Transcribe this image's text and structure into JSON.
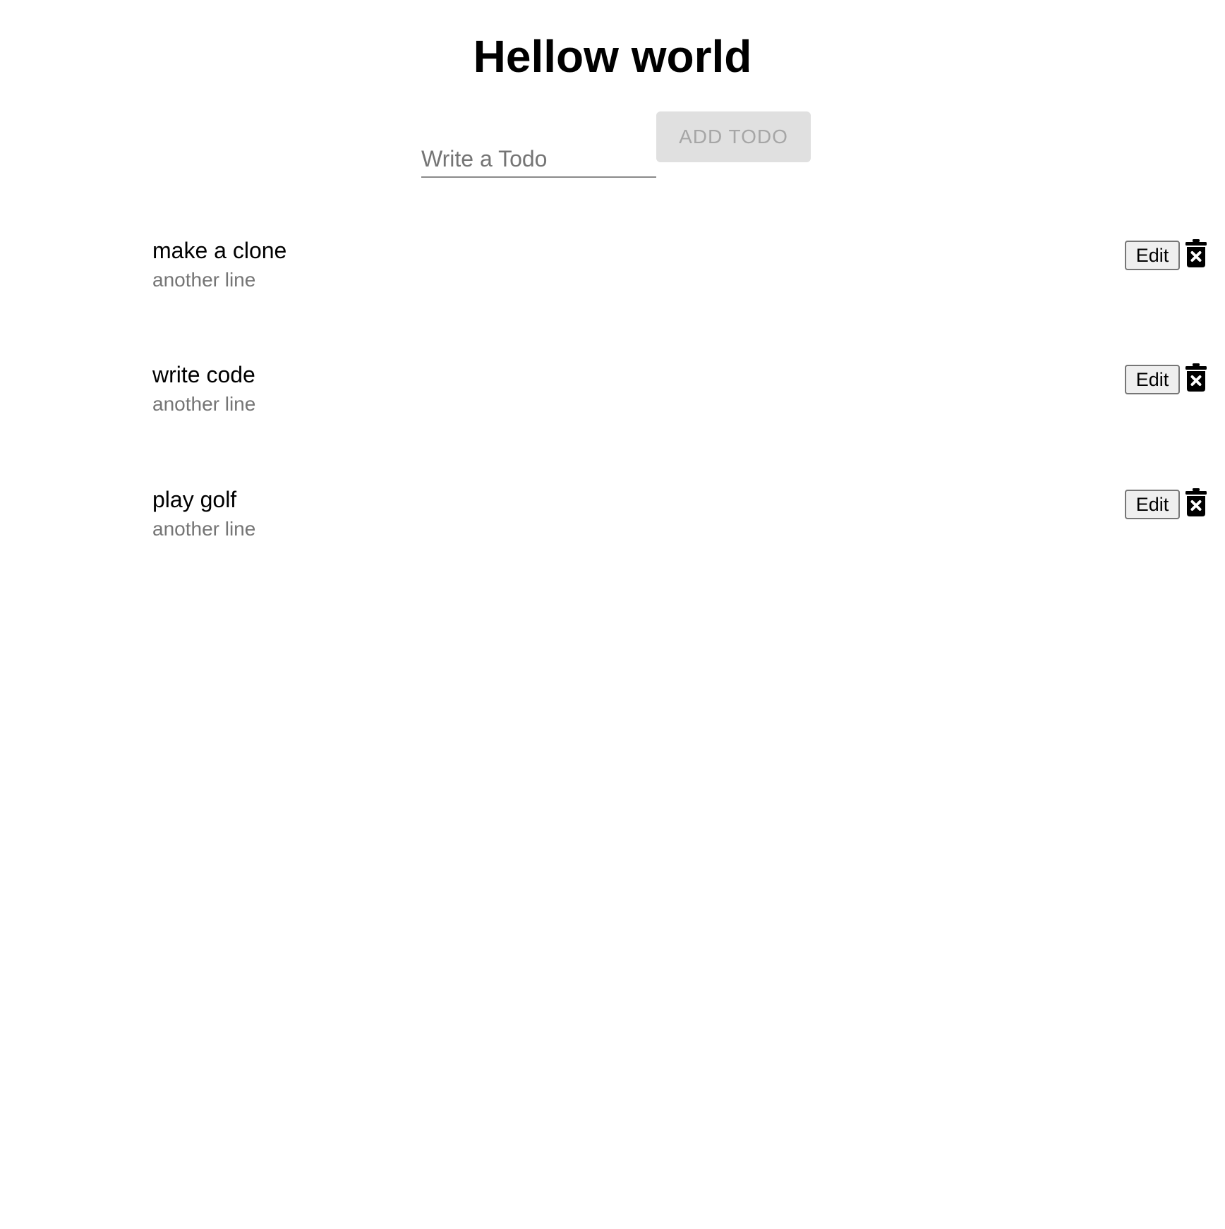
{
  "header": {
    "title": "Hellow world"
  },
  "form": {
    "input_placeholder": "Write a Todo",
    "input_value": "",
    "add_label": "ADD TODO"
  },
  "todos": [
    {
      "title": "make a clone",
      "subtitle": "another line",
      "edit_label": "Edit",
      "delete_icon": "trash-x-icon"
    },
    {
      "title": "write code",
      "subtitle": "another line",
      "edit_label": "Edit",
      "delete_icon": "trash-x-icon"
    },
    {
      "title": "play golf",
      "subtitle": "another line",
      "edit_label": "Edit",
      "delete_icon": "trash-x-icon"
    }
  ],
  "colors": {
    "button_disabled_bg": "#e0e0e0",
    "button_disabled_text": "#a6a6a6",
    "secondary_text": "#757575"
  }
}
